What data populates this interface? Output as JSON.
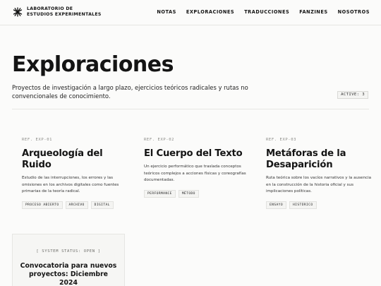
{
  "header": {
    "brand_line1": "LABORATORIO DE",
    "brand_line2": "ESTUDIOS EXPERIMENTALES",
    "logo_icon": "asterisk-burst-icon",
    "nav": [
      "NOTAS",
      "EXPLORACIONES",
      "TRADUCCIONES",
      "FANZINES",
      "NOSOTROS"
    ]
  },
  "hero": {
    "title": "Exploraciones",
    "description": "Proyectos de investigación a largo plazo, ejercicios teóricos radicales y rutas no convencionales de conocimiento.",
    "active_badge": "ACTIVE: 3"
  },
  "cards": [
    {
      "ref": "REF. EXP-01",
      "title": "Arqueología del Ruido",
      "description": "Estudio de las interrupciones, los errores y las omisiones en los archivos digitales como fuentes primarias de la teoría radical.",
      "tags": [
        "PROCESO ABIERTO",
        "ARCHIVO",
        "DIGITAL"
      ]
    },
    {
      "ref": "REF. EXP-02",
      "title": "El Cuerpo del Texto",
      "description": "Un ejercicio performático que traslada conceptos teóricos complejos a acciones físicas y coreografías documentadas.",
      "tags": [
        "PERFORMANCE",
        "MÉTODO"
      ]
    },
    {
      "ref": "REF. EXP-03",
      "title": "Metáforas de la Desaparición",
      "description": "Ruta teórica sobre los vacíos narrativos y la ausencia en la construcción de la historia oficial y sus implicaciones políticas.",
      "tags": [
        "ENSAYO",
        "HISTÓRICO"
      ]
    }
  ],
  "status_card": {
    "label": "[ SYSTEM STATUS: OPEN ]",
    "title": "Convocatoria para nuevos proyectos: Diciembre 2024"
  }
}
